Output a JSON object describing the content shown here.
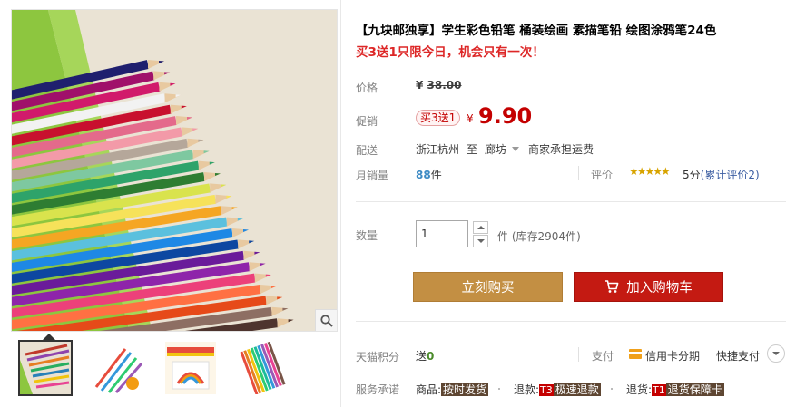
{
  "product": {
    "title": "【九块邮独享】学生彩色铅笔 桶装绘画 素描笔铅 绘图涂鸦笔24色",
    "subtitle": "买3送1只限今日，机会只有一次！"
  },
  "price": {
    "label": "价格",
    "yen": "¥",
    "original": "38.00"
  },
  "promo": {
    "label": "促销",
    "tag": "买3送1",
    "yen": "¥",
    "price": "9.90"
  },
  "shipping": {
    "label": "配送",
    "from": "浙江杭州",
    "to_word": "至",
    "destination": "廊坊",
    "fee": "商家承担运费"
  },
  "sales": {
    "label": "月销量",
    "count": "88",
    "unit": "件"
  },
  "review": {
    "label": "评价",
    "stars": "★★★★★",
    "score": "5分",
    "link": "(累计评价2)"
  },
  "quantity": {
    "label": "数量",
    "value": "1",
    "unit": "件",
    "stock": "(库存2904件)"
  },
  "buttons": {
    "buy": "立刻购买",
    "cart": "加入购物车"
  },
  "points": {
    "label": "天猫积分",
    "prefix": "送",
    "value": "0"
  },
  "payment": {
    "label": "支付",
    "installment": "信用卡分期",
    "quick": "快捷支付"
  },
  "service": {
    "label": "服务承诺",
    "goods_label": "商品:",
    "goods_tag": "按时发货",
    "refund_label": "退款:",
    "refund_code": "T3",
    "refund_tag": "极速退款",
    "return_label": "退货:",
    "return_code": "T1",
    "return_tag": "退货保障卡"
  },
  "colors": {
    "promo_red": "#c40000",
    "buy_button": "#c38f43",
    "cart_button": "#c41a12",
    "sales_blue": "#3c8ac4",
    "star_gold": "#d8a400"
  },
  "icons": {
    "zoom": "magnifier-icon",
    "cart": "cart-icon",
    "card": "credit-card-icon"
  }
}
